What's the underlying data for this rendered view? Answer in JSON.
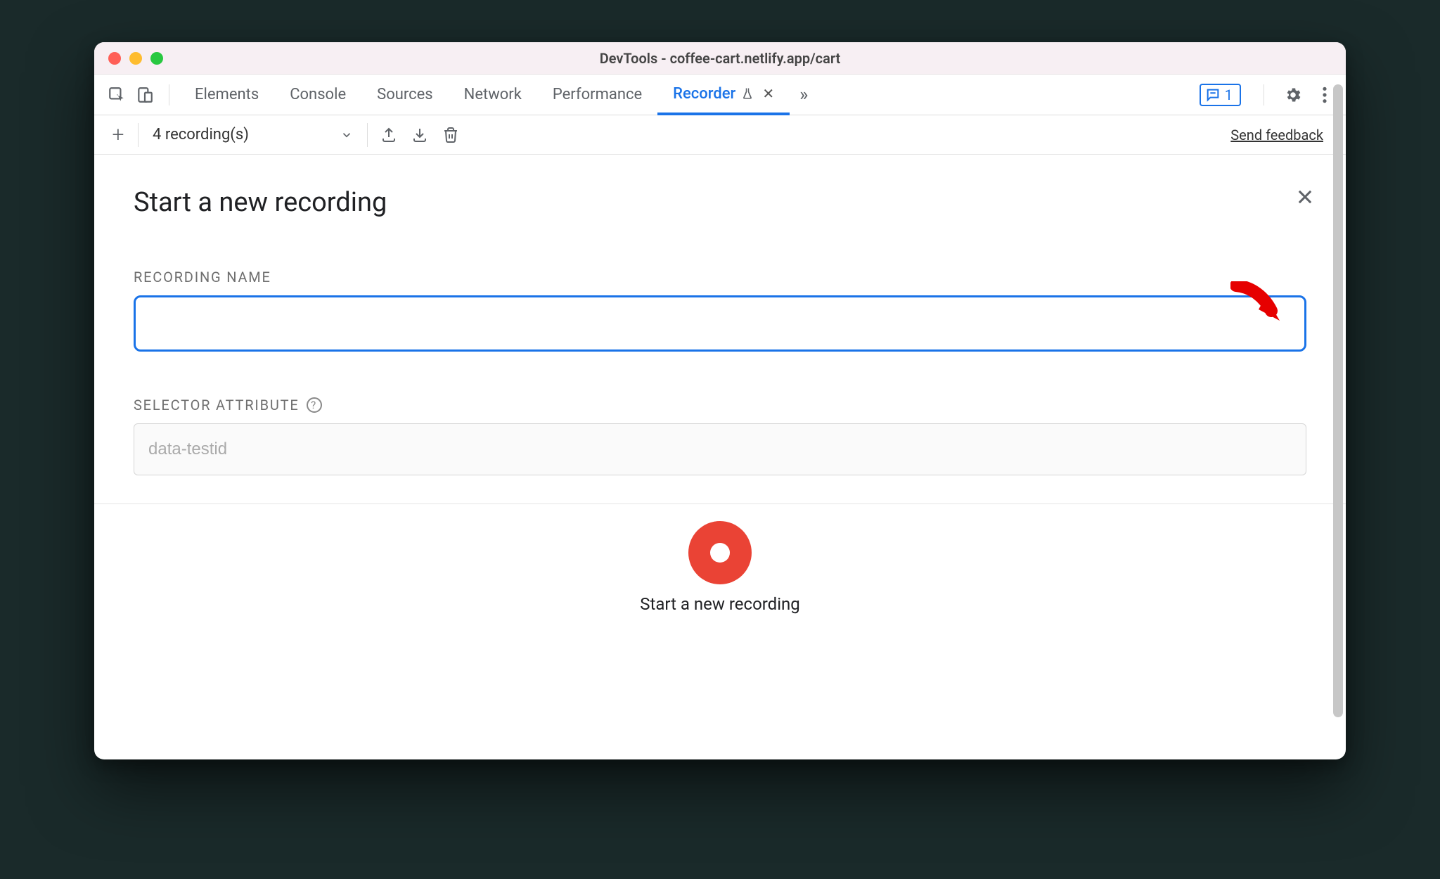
{
  "window": {
    "title": "DevTools - coffee-cart.netlify.app/cart"
  },
  "tabs": {
    "items": [
      "Elements",
      "Console",
      "Sources",
      "Network",
      "Performance",
      "Recorder"
    ],
    "active_index": 5,
    "message_count": "1"
  },
  "subbar": {
    "dropdown_label": "4 recording(s)",
    "feedback_label": "Send feedback"
  },
  "panel": {
    "heading": "Start a new recording",
    "recording_name_label": "RECORDING NAME",
    "recording_name_value": "",
    "selector_attr_label": "SELECTOR ATTRIBUTE",
    "selector_attr_placeholder": "data-testid",
    "selector_attr_value": ""
  },
  "footer": {
    "start_label": "Start a new recording"
  }
}
